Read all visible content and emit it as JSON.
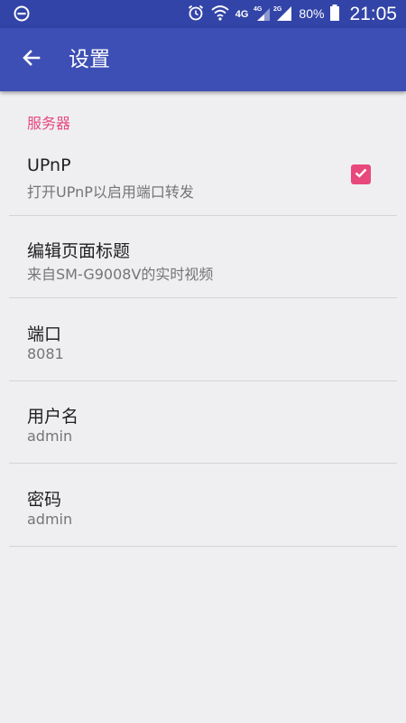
{
  "status_bar": {
    "network_4g": "4G",
    "sim1_label": "4G",
    "sim2_label": "2G",
    "battery": "80%",
    "time": "21:05",
    "icons": [
      "do-not-disturb-icon",
      "alarm-icon",
      "wifi-icon",
      "signal-icon",
      "battery-icon"
    ]
  },
  "app_bar": {
    "title": "设置",
    "back_icon": "arrow-back-icon"
  },
  "category": {
    "title": "服务器"
  },
  "preferences": [
    {
      "title": "UPnP",
      "summary": "打开UPnP以启用端口转发",
      "checked": true
    },
    {
      "title": "编辑页面标题",
      "summary": "来自SM-G9008V的实时视频"
    },
    {
      "title": "端口",
      "summary": "8081"
    },
    {
      "title": "用户名",
      "summary": "admin"
    },
    {
      "title": "密码",
      "summary": "admin"
    }
  ],
  "colors": {
    "status_bar": "#3344a8",
    "app_bar": "#3d4fb5",
    "accent": "#e8487c",
    "background": "#efeff2"
  }
}
